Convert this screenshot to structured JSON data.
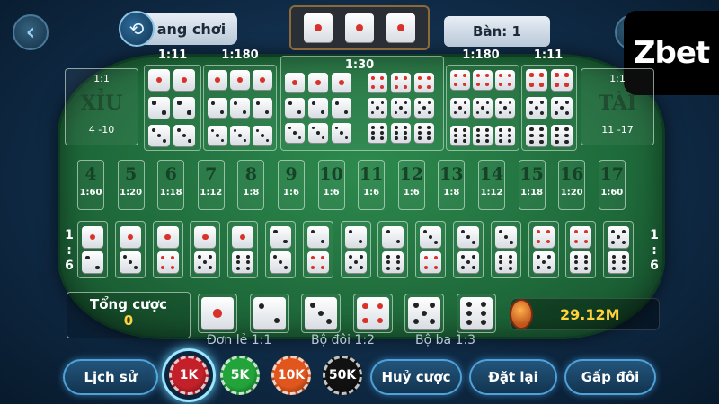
{
  "header": {
    "back_icon": "back-arrow-icon",
    "history_label": "ang chơi",
    "history_icon": "history-clock-icon",
    "last_result": [
      1,
      1,
      1
    ],
    "table_label": "Bàn: 1",
    "logo_text": "Zbet"
  },
  "board": {
    "double_left_ratio": "1:11",
    "triple_left_ratio": "1:180",
    "any_triple_ratio": "1:30",
    "triple_right_ratio": "1:180",
    "double_right_ratio": "1:11",
    "small": {
      "ratio": "1:1",
      "label": "XỈU",
      "range": "4 -10"
    },
    "big": {
      "ratio": "1:1",
      "label": "TÀI",
      "range": "11 -17"
    },
    "sums": [
      {
        "n": "4",
        "odds": "1:60"
      },
      {
        "n": "5",
        "odds": "1:20"
      },
      {
        "n": "6",
        "odds": "1:18"
      },
      {
        "n": "7",
        "odds": "1:12"
      },
      {
        "n": "8",
        "odds": "1:8"
      },
      {
        "n": "9",
        "odds": "1:6"
      },
      {
        "n": "10",
        "odds": "1:6"
      },
      {
        "n": "11",
        "odds": "1:6"
      },
      {
        "n": "12",
        "odds": "1:6"
      },
      {
        "n": "13",
        "odds": "1:8"
      },
      {
        "n": "14",
        "odds": "1:12"
      },
      {
        "n": "15",
        "odds": "1:18"
      },
      {
        "n": "16",
        "odds": "1:20"
      },
      {
        "n": "17",
        "odds": "1:60"
      }
    ],
    "pair_ratio": {
      "a": "1",
      "sep": ":",
      "b": "6"
    },
    "pairs": [
      [
        1,
        2
      ],
      [
        1,
        3
      ],
      [
        1,
        4
      ],
      [
        1,
        5
      ],
      [
        1,
        6
      ],
      [
        2,
        3
      ],
      [
        2,
        4
      ],
      [
        2,
        5
      ],
      [
        2,
        6
      ],
      [
        3,
        4
      ],
      [
        3,
        5
      ],
      [
        3,
        6
      ],
      [
        4,
        5
      ],
      [
        4,
        6
      ],
      [
        5,
        6
      ]
    ]
  },
  "footer": {
    "total_label": "Tổng cược",
    "total_value": "0",
    "singles": [
      1,
      2,
      3,
      4,
      5,
      6
    ],
    "balance": "29.12M",
    "legend_single": "Đơn lẻ 1:1",
    "legend_double": "Bộ đôi 1:2",
    "legend_triple": "Bộ ba 1:3",
    "history_button": "Lịch sử",
    "chips": [
      {
        "label": "1K",
        "color": "#c3202a"
      },
      {
        "label": "5K",
        "color": "#23a43a"
      },
      {
        "label": "10K",
        "color": "#e0561c"
      },
      {
        "label": "50K",
        "color": "#111111"
      }
    ],
    "cancel_button": "Huỷ cược",
    "reset_button": "Đặt lại",
    "double_button": "Gấp đôi"
  }
}
